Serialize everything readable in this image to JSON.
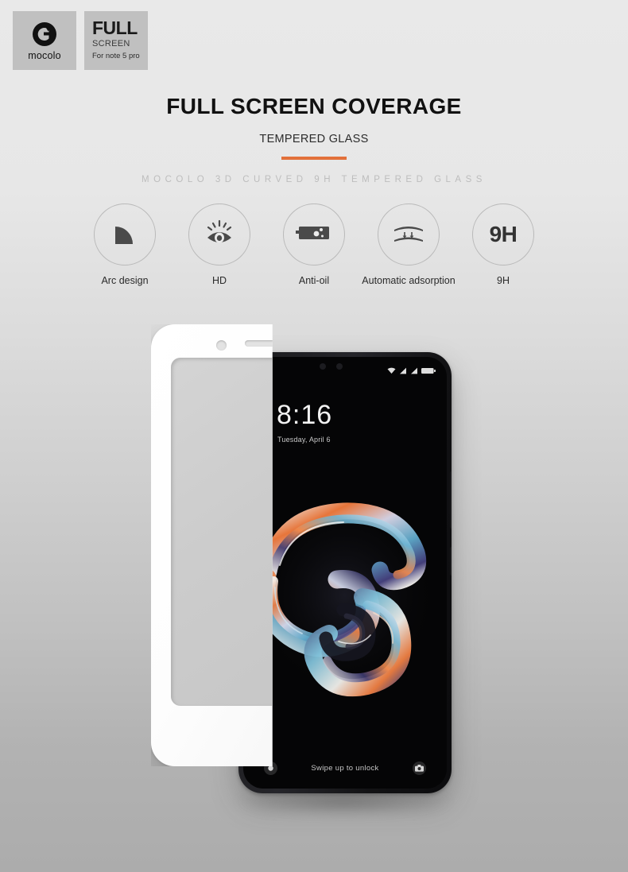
{
  "brand": {
    "logo_icon": "mocolo-c-arrow-logo",
    "logo_word": "mocolo",
    "full_label": "FULL",
    "screen_label": "SCREEN",
    "model_label": "For  note 5 pro"
  },
  "heading": {
    "title": "FULL SCREEN COVERAGE",
    "subtitle": "TEMPERED GLASS",
    "accent_color": "#e2703a",
    "tracking_line": "MOCOLO 3D CURVED 9H TEMPERED GLASS"
  },
  "features": [
    {
      "label": "Arc design",
      "icon": "arc-quarter-icon"
    },
    {
      "label": "HD",
      "icon": "eye-icon"
    },
    {
      "label": "Anti-oil",
      "icon": "oil-droplet-repel-icon"
    },
    {
      "label": "Automatic adsorption",
      "icon": "adsorption-arrows-icon"
    },
    {
      "label": "9H",
      "icon": "hardness-9h-icon",
      "glyph": "9H"
    }
  ],
  "phone": {
    "lockscreen": {
      "time": "8:16",
      "date": "Tuesday, April 6",
      "swipe_hint": "Swipe up to unlock",
      "torch_icon": "flashlight-icon",
      "camera_icon": "camera-icon"
    },
    "statusbar": {
      "wifi_icon": "wifi-icon",
      "signal1_icon": "signal-bars-icon",
      "signal2_icon": "signal-bars-icon",
      "battery_icon": "battery-full-icon"
    },
    "hardware": {
      "volume_button": "volume-rocker",
      "power_button": "power-button"
    }
  },
  "glass_overlay": {
    "name": "tempered-glass-protector",
    "speaker_cutout": "earpiece-speaker-cutout",
    "camera_cutout": "front-camera-cutout",
    "sensor_cutouts": "proximity-sensor-cutouts"
  },
  "background": {
    "top_color": "#e9e9e9",
    "bottom_color": "#acacac"
  }
}
